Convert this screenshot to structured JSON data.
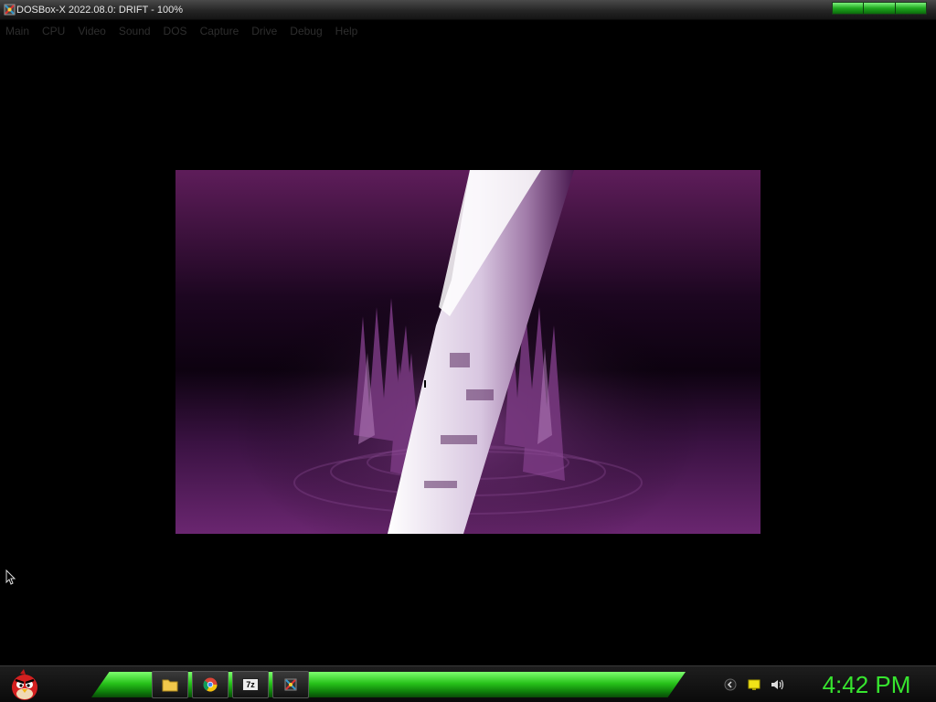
{
  "window": {
    "title": "DOSBox-X 2022.08.0: DRIFT - 100%",
    "icon": "dosbox-icon",
    "controls": [
      "minimize-button",
      "maximize-button",
      "close-button"
    ]
  },
  "menubar": {
    "items": [
      {
        "label": "Main"
      },
      {
        "label": "CPU"
      },
      {
        "label": "Video"
      },
      {
        "label": "Sound"
      },
      {
        "label": "DOS"
      },
      {
        "label": "Capture"
      },
      {
        "label": "Drive"
      },
      {
        "label": "Debug"
      },
      {
        "label": "Help"
      }
    ]
  },
  "game": {
    "name": "DRIFT",
    "description_icon": "purple-abstract-scene"
  },
  "taskbar": {
    "start_icon": "angry-bird-icon",
    "pinned": [
      {
        "name": "file-explorer",
        "icon": "folder-icon"
      },
      {
        "name": "chrome",
        "icon": "chrome-icon"
      },
      {
        "name": "7zip",
        "icon": "7zip-icon",
        "label": "7z"
      },
      {
        "name": "dosbox",
        "icon": "dosbox-icon"
      }
    ],
    "tray": [
      "show-hidden-icon",
      "action-center-icon",
      "volume-icon"
    ],
    "clock": "4:42 PM",
    "accent": "#37e52f"
  }
}
